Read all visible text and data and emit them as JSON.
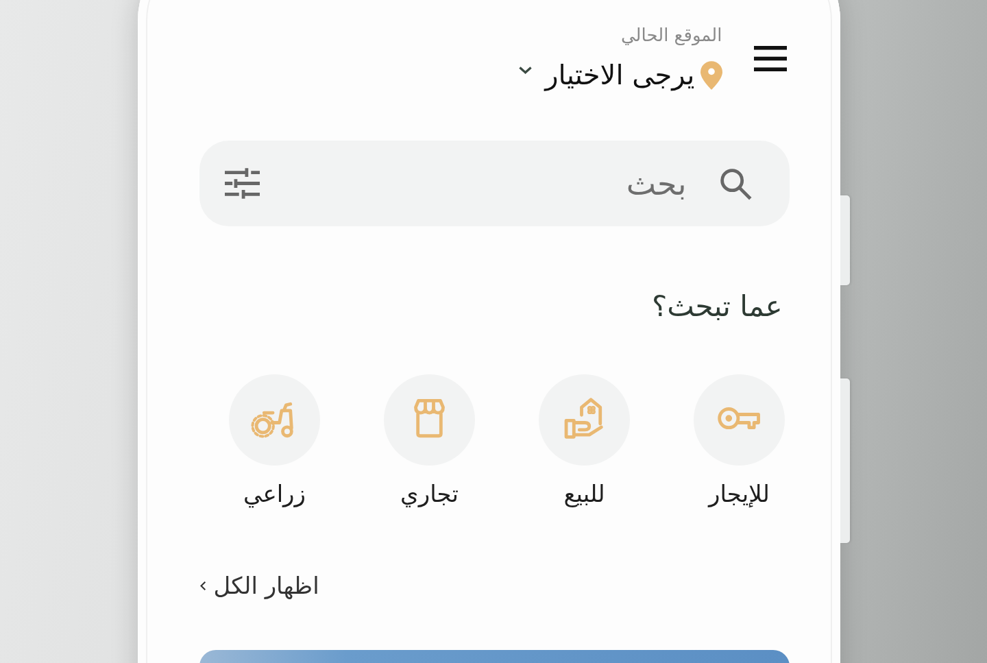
{
  "header": {
    "location_label": "الموقع الحالي",
    "location_value": "يرجى الاختيار"
  },
  "search": {
    "placeholder": "بحث"
  },
  "categories": {
    "title": "عما تبحث؟",
    "items": [
      {
        "label": "للإيجار"
      },
      {
        "label": "للبيع"
      },
      {
        "label": "تجاري"
      },
      {
        "label": "زراعي"
      }
    ]
  },
  "show_all": {
    "label": "اظهار الكل"
  }
}
